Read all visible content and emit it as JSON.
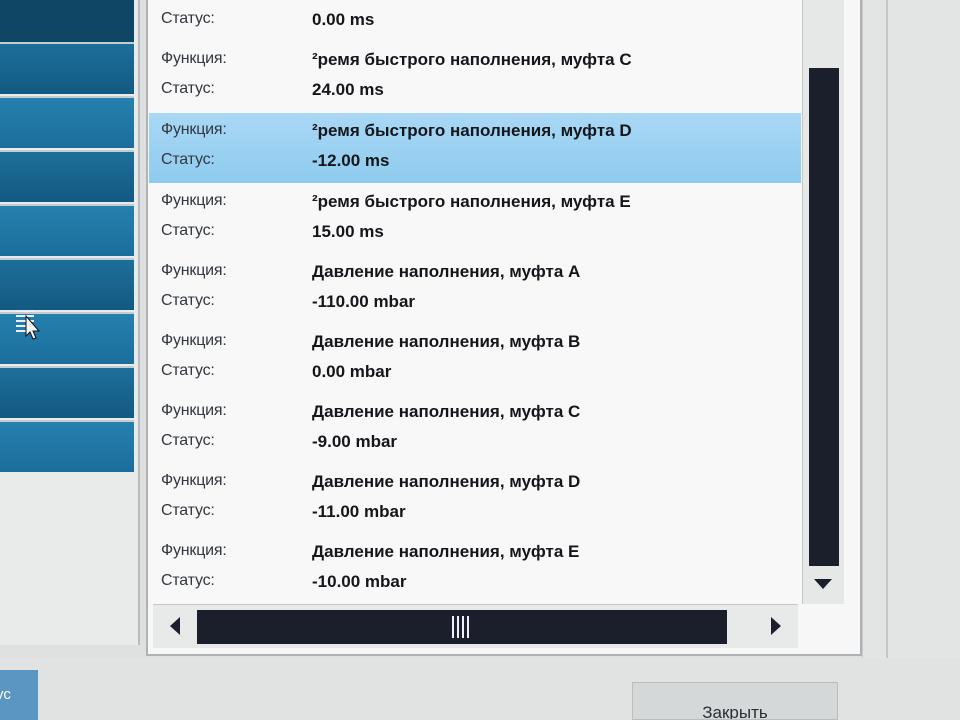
{
  "list": {
    "entries": [
      {
        "function_label": "",
        "function": "",
        "status_label": "Статус:",
        "status": "0.00 ms"
      },
      {
        "function_label": "Функция:",
        "function": "²ремя быстрого наполнения, муфта C",
        "status_label": "Статус:",
        "status": "24.00 ms"
      },
      {
        "function_label": "Функция:",
        "function": "²ремя быстрого наполнения, муфта D",
        "status_label": "Статус:",
        "status": "-12.00 ms",
        "selected": true
      },
      {
        "function_label": "Функция:",
        "function": "²ремя быстрого наполнения, муфта E",
        "status_label": "Статус:",
        "status": "15.00 ms"
      },
      {
        "function_label": "Функция:",
        "function": "Давление наполнения, муфта A",
        "status_label": "Статус:",
        "status": "-110.00 mbar"
      },
      {
        "function_label": "Функция:",
        "function": "Давление наполнения, муфта B",
        "status_label": "Статус:",
        "status": "0.00 mbar"
      },
      {
        "function_label": "Функция:",
        "function": "Давление наполнения, муфта C",
        "status_label": "Статус:",
        "status": "-9.00 mbar"
      },
      {
        "function_label": "Функция:",
        "function": "Давление наполнения, муфта D",
        "status_label": "Статус:",
        "status": "-11.00 mbar"
      },
      {
        "function_label": "Функция:",
        "function": "Давление наполнения, муфта E",
        "status_label": "Статус:",
        "status": "-10.00 mbar"
      }
    ]
  },
  "footer": {
    "status_button_label": "ус",
    "close_button_label": "Закрыть"
  },
  "icons": {
    "scroll_down": "triangle-down",
    "scroll_left": "triangle-left",
    "scroll_right": "triangle-right",
    "grip": "grip-lines",
    "cursor": "mouse-pointer"
  },
  "colors": {
    "selection": "#8ecbee",
    "nav_tile": "#135a82",
    "scroll_thumb": "#1b1f2b"
  }
}
